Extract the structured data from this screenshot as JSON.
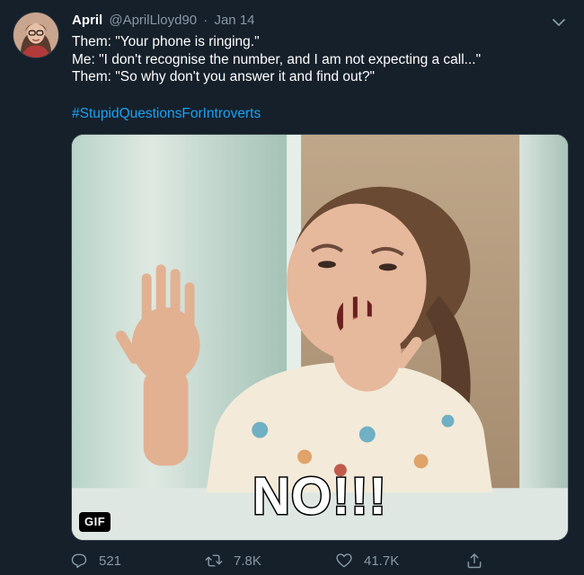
{
  "tweet": {
    "author_name": "April",
    "author_handle": "@AprilLloyd90",
    "separator": "·",
    "date": "Jan 14",
    "lines": [
      "Them: \"Your phone is ringing.\"",
      "Me: \"I don't recognise the number, and I am not expecting a call...\"",
      "Them: \"So why don't you answer it and find out?\""
    ],
    "hashtag": "#StupidQuestionsForIntroverts"
  },
  "media": {
    "badge": "GIF",
    "caption": "NO!!!"
  },
  "actions": {
    "replies": "521",
    "retweets": "7.8K",
    "likes": "41.7K"
  },
  "colors": {
    "background": "#15202b",
    "text": "#ffffff",
    "secondary": "#8899a6",
    "link": "#1da1f2"
  },
  "icons": {
    "menu": "chevron-down-icon",
    "reply": "reply-icon",
    "retweet": "retweet-icon",
    "like": "heart-icon",
    "share": "share-icon"
  }
}
